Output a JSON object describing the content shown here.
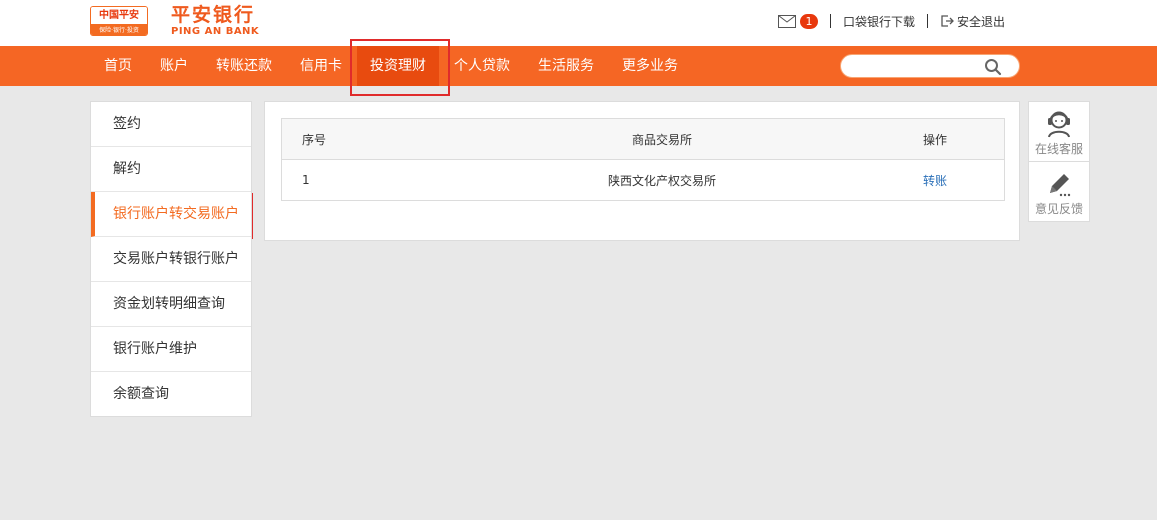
{
  "header": {
    "logo_line1": "中国平安",
    "logo_line2": "保险·银行·投资",
    "brand_cn": "平安银行",
    "brand_en": "PING AN BANK",
    "mail_count": "1",
    "app_download": "口袋银行下载",
    "logout": "安全退出"
  },
  "nav": {
    "items": [
      "首页",
      "账户",
      "转账还款",
      "信用卡",
      "投资理财",
      "个人贷款",
      "生活服务",
      "更多业务"
    ],
    "active": "投资理财",
    "search_placeholder": ""
  },
  "sidebar": {
    "items": [
      "签约",
      "解约",
      "银行账户转交易账户",
      "交易账户转银行账户",
      "资金划转明细查询",
      "银行账户维护",
      "余额查询"
    ],
    "active": "银行账户转交易账户"
  },
  "table": {
    "headers": [
      "序号",
      "商品交易所",
      "操作"
    ],
    "rows": [
      {
        "index": "1",
        "exchange": "陕西文化产权交易所",
        "action": "转账"
      }
    ]
  },
  "float_panel": {
    "service": "在线客服",
    "feedback": "意见反馈"
  },
  "colors": {
    "brand_orange": "#f56624",
    "nav_active": "#e84b0f",
    "link_blue": "#2a6fb8",
    "highlight_red": "#e02b2b"
  }
}
